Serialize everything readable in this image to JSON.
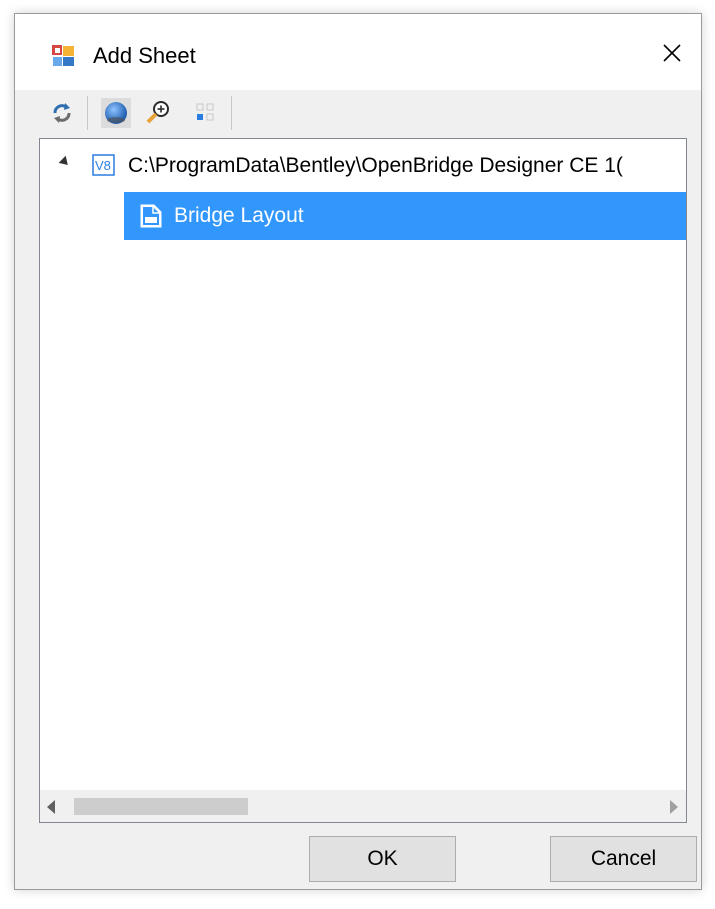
{
  "dialog": {
    "title": "Add Sheet",
    "close_symbol": "✕"
  },
  "toolbar": {
    "icons": [
      "refresh-icon",
      "globe-icon",
      "zoom-in-icon",
      "grid-view-icon"
    ]
  },
  "tree": {
    "root": {
      "label": "C:\\ProgramData\\Bentley\\OpenBridge Designer CE 1(",
      "icon": "v8-file-icon",
      "expanded": true
    },
    "children": [
      {
        "label": "Bridge Layout",
        "icon": "sheet-icon",
        "selected": true
      }
    ]
  },
  "buttons": {
    "ok_label": "OK",
    "cancel_label": "Cancel"
  },
  "colors": {
    "selection": "#3297fd",
    "window_bg": "#f0f0f0"
  }
}
